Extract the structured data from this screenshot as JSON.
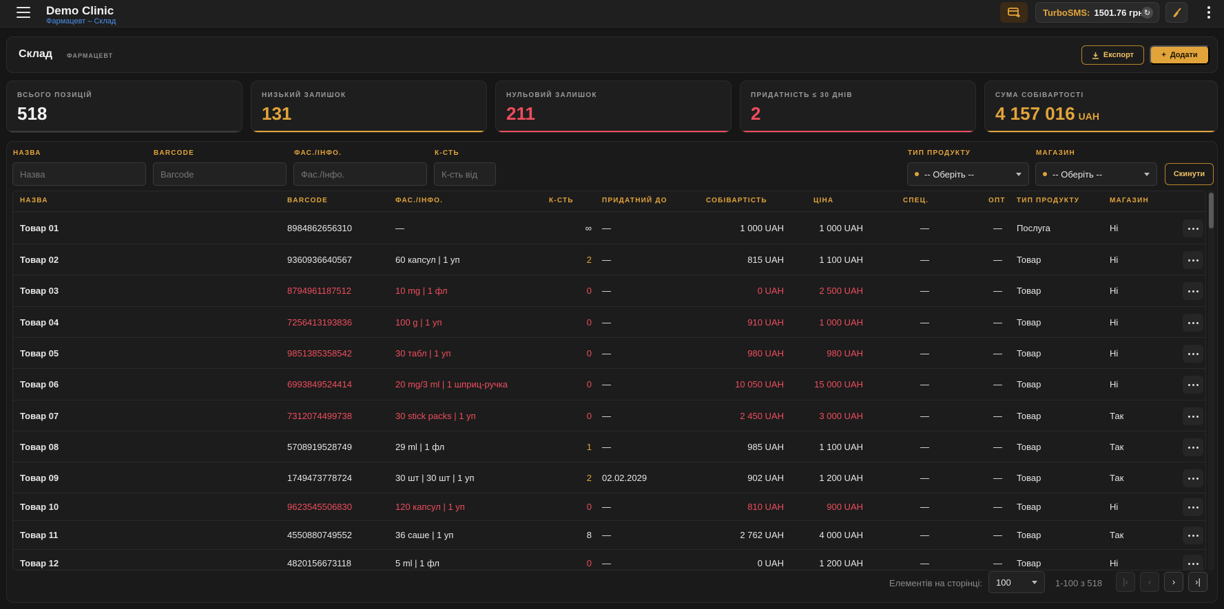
{
  "topbar": {
    "title": "Demo Clinic",
    "subtitle": "Фармацевт – Склад",
    "sms_label": "TurboSMS:",
    "sms_value": "1501.76 грн"
  },
  "header": {
    "title": "Склад",
    "role": "ФАРМАЦЕВТ",
    "export_label": "Експорт",
    "add_label": "Додати"
  },
  "stats": [
    {
      "label": "ВСЬОГО ПОЗИЦІЙ",
      "value": "518",
      "unit": "",
      "color": "#f2f2f2",
      "bar": "#3a3a3a"
    },
    {
      "label": "НИЗЬКИЙ ЗАЛИШОК",
      "value": "131",
      "unit": "",
      "color": "#e2a43a",
      "bar": "#e2a43a"
    },
    {
      "label": "НУЛЬОВИЙ ЗАЛИШОК",
      "value": "211",
      "unit": "",
      "color": "#ee4d5d",
      "bar": "#ee4d5d"
    },
    {
      "label": "ПРИДАТНІСТЬ ≤ 30 ДНІВ",
      "value": "2",
      "unit": "",
      "color": "#ee4d5d",
      "bar": "#ee4d5d"
    },
    {
      "label": "СУМА СОБІВАРТОСТІ",
      "value": "4 157 016",
      "unit": "UAH",
      "color": "#e2a43a",
      "bar": "#e2a43a"
    }
  ],
  "filters": {
    "name_label": "НАЗВА",
    "name_placeholder": "Назва",
    "barcode_label": "BARCODE",
    "barcode_placeholder": "Barcode",
    "pack_label": "ФАС./ІНФО.",
    "pack_placeholder": "Фас./Інфо.",
    "qty_label": "К-СТЬ",
    "qty_placeholder": "К-сть від",
    "type_label": "ТИП ПРОДУКТУ",
    "type_value": "-- Оберіть --",
    "shop_label": "МАГАЗИН",
    "shop_value": "-- Оберіть --",
    "reset_label": "Скинути"
  },
  "table": {
    "headers": {
      "name": "НАЗВА",
      "barcode": "BARCODE",
      "pack": "ФАС./ІНФО.",
      "qty": "К-СТЬ",
      "expiry": "ПРИДАТНИЙ ДО",
      "cost": "СОБІВАРТІСТЬ",
      "price": "ЦІНА",
      "spec": "СПЕЦ.",
      "opt": "ОПТ",
      "type": "ТИП ПРОДУКТУ",
      "shop": "МАГАЗИН"
    },
    "rows": [
      {
        "name": "Товар 01",
        "barcode": "8984862656310",
        "pack": "—",
        "qty": "∞",
        "expiry": "—",
        "cost": "1 000 UAH",
        "price": "1 000 UAH",
        "spec": "—",
        "opt": "—",
        "type": "Послуга",
        "shop": "Ні",
        "state": "normal"
      },
      {
        "name": "Товар 02",
        "barcode": "9360936640567",
        "pack": "60 капсул | 1 уп",
        "qty": "2",
        "expiry": "—",
        "cost": "815 UAH",
        "price": "1 100 UAH",
        "spec": "—",
        "opt": "—",
        "type": "Товар",
        "shop": "Ні",
        "state": "low"
      },
      {
        "name": "Товар 03",
        "barcode": "8794961187512",
        "pack": "10 mg | 1 фл",
        "qty": "0",
        "expiry": "—",
        "cost": "0 UAH",
        "price": "2 500 UAH",
        "spec": "—",
        "opt": "—",
        "type": "Товар",
        "shop": "Ні",
        "state": "zero"
      },
      {
        "name": "Товар 04",
        "barcode": "7256413193836",
        "pack": "100 g | 1 уп",
        "qty": "0",
        "expiry": "—",
        "cost": "910 UAH",
        "price": "1 000 UAH",
        "spec": "—",
        "opt": "—",
        "type": "Товар",
        "shop": "Ні",
        "state": "zero"
      },
      {
        "name": "Товар 05",
        "barcode": "9851385358542",
        "pack": "30 табл | 1 уп",
        "qty": "0",
        "expiry": "—",
        "cost": "980 UAH",
        "price": "980 UAH",
        "spec": "—",
        "opt": "—",
        "type": "Товар",
        "shop": "Ні",
        "state": "zero"
      },
      {
        "name": "Товар 06",
        "barcode": "6993849524414",
        "pack": "20 mg/3 ml | 1 шприц-ручка",
        "qty": "0",
        "expiry": "—",
        "cost": "10 050 UAH",
        "price": "15 000 UAH",
        "spec": "—",
        "opt": "—",
        "type": "Товар",
        "shop": "Ні",
        "state": "zero"
      },
      {
        "name": "Товар 07",
        "barcode": "7312074499738",
        "pack": "30 stick packs | 1 уп",
        "qty": "0",
        "expiry": "—",
        "cost": "2 450 UAH",
        "price": "3 000 UAH",
        "spec": "—",
        "opt": "—",
        "type": "Товар",
        "shop": "Так",
        "state": "zero"
      },
      {
        "name": "Товар 08",
        "barcode": "5708919528749",
        "pack": "29 ml | 1 фл",
        "qty": "1",
        "expiry": "—",
        "cost": "985 UAH",
        "price": "1 100 UAH",
        "spec": "—",
        "opt": "—",
        "type": "Товар",
        "shop": "Так",
        "state": "low"
      },
      {
        "name": "Товар 09",
        "barcode": "1749473778724",
        "pack": "30 шт | 30 шт | 1 уп",
        "qty": "2",
        "expiry": "02.02.2029",
        "cost": "902 UAH",
        "price": "1 200 UAH",
        "spec": "—",
        "opt": "—",
        "type": "Товар",
        "shop": "Так",
        "state": "low"
      },
      {
        "name": "Товар 10",
        "barcode": "9623545506830",
        "pack": "120 капсул | 1 уп",
        "qty": "0",
        "expiry": "—",
        "cost": "810 UAH",
        "price": "900 UAH",
        "spec": "—",
        "opt": "—",
        "type": "Товар",
        "shop": "Ні",
        "state": "zero"
      },
      {
        "name": "Товар 11",
        "barcode": "4550880749552",
        "pack": "36 саше | 1 уп",
        "qty": "8",
        "expiry": "—",
        "cost": "2 762 UAH",
        "price": "4 000 UAH",
        "spec": "—",
        "opt": "—",
        "type": "Товар",
        "shop": "Так",
        "state": "normal"
      },
      {
        "name": "Товар 12",
        "barcode": "4820156673118",
        "pack": "5 ml | 1 фл",
        "qty": "0",
        "expiry": "—",
        "cost": "0 UAH",
        "price": "1 200 UAH",
        "spec": "—",
        "opt": "—",
        "type": "Товар",
        "shop": "Ні",
        "state": "zeroqty"
      }
    ]
  },
  "pagination": {
    "per_page_label": "Елементів на сторінці:",
    "per_page_value": "100",
    "range": "1-100 з 518",
    "first": "|‹",
    "prev": "‹",
    "next": "›",
    "last": "›|"
  },
  "colors": {
    "accent": "#e2a43a",
    "danger": "#ee4d5d"
  }
}
